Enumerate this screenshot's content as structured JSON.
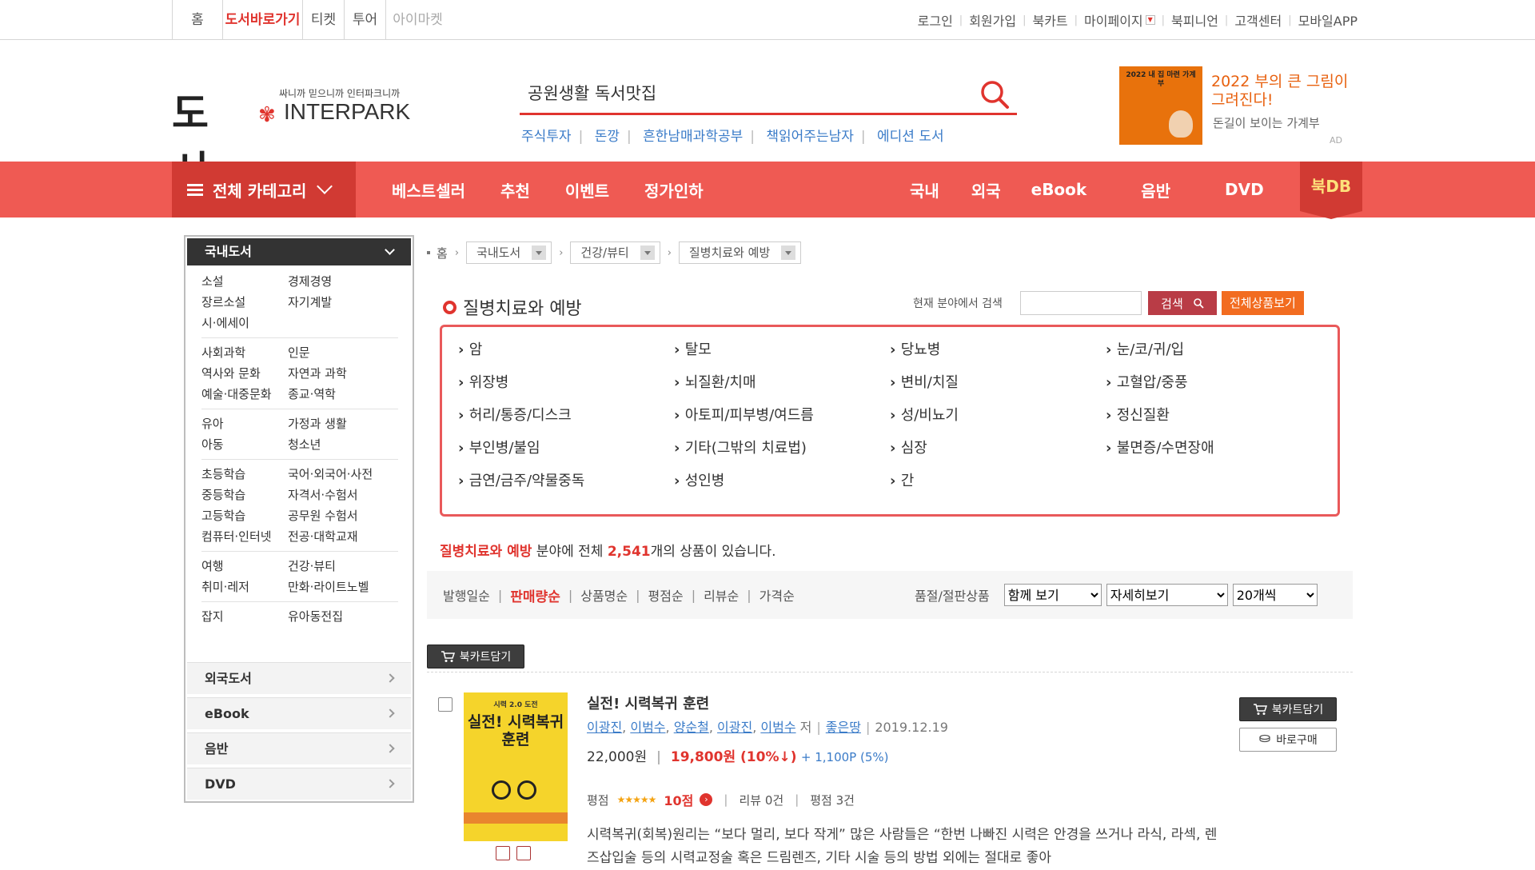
{
  "topbar": {
    "services": [
      "홈",
      "도서바로가기",
      "티켓",
      "투어",
      "아이마켓"
    ],
    "active_service": "도서바로가기",
    "util": [
      "로그인",
      "회원가입",
      "북카트",
      "마이페이지",
      "북피니언",
      "고객센터",
      "모바일APP"
    ]
  },
  "header": {
    "logo_text": "도서",
    "logo_slogan": "싸니까 믿으니까 인터파크니까",
    "logo_brand": "INTERPARK",
    "search_value": "공원생활 독서맛집",
    "keywords": [
      "주식투자",
      "돈깡",
      "흔한남매과학공부",
      "책읽어주는남자",
      "에디션 도서"
    ],
    "ad": {
      "thumb_title": "2022 내 집 마련 가계부",
      "headline": "2022 부의 큰 그림이 그려진다!",
      "subtext": "돈길이 보이는 가계부",
      "tag": "AD"
    }
  },
  "gnb": {
    "category_label": "전체 카테고리",
    "main": [
      "베스트셀러",
      "추천",
      "이벤트",
      "정가인하"
    ],
    "right": [
      "국내",
      "외국",
      "eBook",
      "음반",
      "DVD"
    ],
    "bookdb": "북DB",
    "colors": {
      "bar": "#ef5a53",
      "accent": "#d13a33"
    }
  },
  "sidebar": {
    "title": "국내도서",
    "groups": [
      [
        "소설",
        "경제경영",
        "장르소설",
        "자기계발",
        "시·에세이",
        ""
      ],
      [
        "사회과학",
        "인문",
        "역사와 문화",
        "자연과 과학",
        "예술·대중문화",
        "종교·역학"
      ],
      [
        "유아",
        "가정과 생활",
        "아동",
        "청소년"
      ],
      [
        "초등학습",
        "국어·외국어·사전",
        "중등학습",
        "자격서·수험서",
        "고등학습",
        "공무원 수험서",
        "컴퓨터·인터넷",
        "전공·대학교재"
      ],
      [
        "여행",
        "건강·뷰티",
        "취미·레저",
        "만화·라이트노벨"
      ],
      [
        "잡지",
        "유아동전집"
      ]
    ],
    "sections": [
      "외국도서",
      "eBook",
      "음반",
      "DVD"
    ]
  },
  "breadcrumb": {
    "home": "홈",
    "levels": [
      "국내도서",
      "건강/뷰티",
      "질병치료와 예방"
    ]
  },
  "category": {
    "title": "질병치료와 예방",
    "search_label": "현재 분야에서 검색",
    "search_button": "검색",
    "all_button": "전체상품보기",
    "subcategories": [
      "암",
      "탈모",
      "당뇨병",
      "눈/코/귀/입",
      "위장병",
      "뇌질환/치매",
      "변비/치질",
      "고혈압/중풍",
      "허리/통증/디스크",
      "아토피/피부병/여드름",
      "성/비뇨기",
      "정신질환",
      "부인병/불임",
      "기타(그밖의 치료법)",
      "심장",
      "불면증/수면장애",
      "금연/금주/약물중독",
      "성인병",
      "간"
    ],
    "result": {
      "field": "질병치료와 예방",
      "prefix": " 분야에 전체 ",
      "count": "2,541",
      "suffix": "개의 상품이 있습니다."
    }
  },
  "sort": {
    "options": [
      "발행일순",
      "판매량순",
      "상품명순",
      "평점순",
      "리뷰순",
      "가격순"
    ],
    "active": "판매량순",
    "soldout_label": "품절/절판상품",
    "select_view": "함께 보기",
    "select_detail": "자세히보기",
    "select_count": "20개씩"
  },
  "cart_label": "북카트담기",
  "product": {
    "title": "실전! 시력복귀 훈련",
    "authors": [
      "이광진",
      "이범수",
      "양순철",
      "이광진",
      "이범수"
    ],
    "author_suffix": "저",
    "publisher": "좋은땅",
    "date": "2019.12.19",
    "list_price": "22,000원",
    "sale_price": "19,800원 (10%↓)",
    "points": "+ 1,100P (5%)",
    "rating_label": "평점",
    "rating_stars": 5,
    "rating_points": "10점",
    "review": "리뷰 0건",
    "rating_count": "평점 3건",
    "desc": "시력복귀(회복)원리는 “보다 멀리, 보다 작게” 많은 사람들은 “한번 나빠진 시력은 안경을 쓰거나 라식, 라섹, 렌즈삽입술 등의 시력교정술 혹은 드림렌즈, 기타 시술 등의 방법 외에는 절대로 좋아",
    "cover_top": "시력 2.0 도전",
    "cover_title": "실전! 시력복귀 훈련",
    "cart_button": "북카트담기",
    "buy_button": "바로구매"
  }
}
